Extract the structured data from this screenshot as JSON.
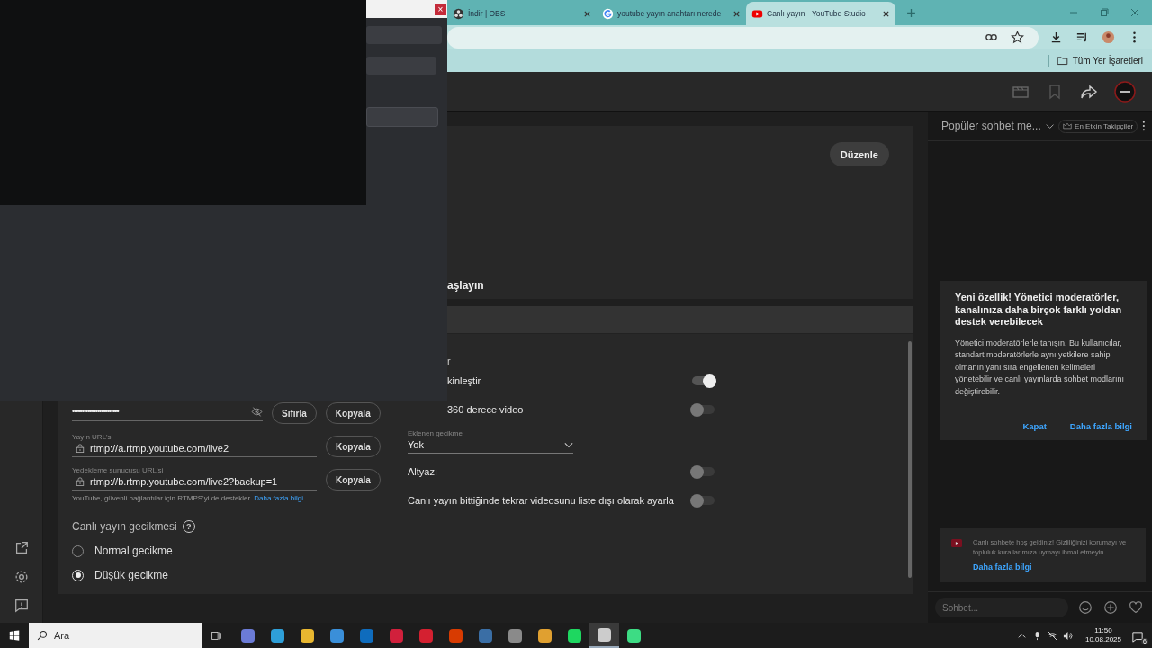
{
  "browser": {
    "tabs": [
      {
        "title": "İndir | OBS",
        "kind": "obs",
        "selected": false
      },
      {
        "title": "youtube yayın anahtarı nerede",
        "kind": "google",
        "selected": false
      },
      {
        "title": "Canlı yayın - YouTube Studio",
        "kind": "youtube",
        "selected": true
      }
    ],
    "bookmarks_folder": "Tüm Yer İşaretleri"
  },
  "overlay_window": {
    "close": "×"
  },
  "studio": {
    "edit_button": "Düzenle",
    "partial_heading": "aşlayın",
    "section_fragment": "r",
    "stream_key": {
      "masked": "••••••••••••••••••••••••",
      "reset": "Sıfırla",
      "copy": "Kopyala"
    },
    "stream_url": {
      "label": "Yayın URL'si",
      "value": "rtmp://a.rtmp.youtube.com/live2",
      "copy": "Kopyala"
    },
    "backup_url": {
      "label": "Yedekleme sunucusu URL'si",
      "value": "rtmp://b.rtmp.youtube.com/live2?backup=1",
      "copy": "Kopyala"
    },
    "rtmps_note": "YouTube, güvenli bağlantılar için RTMPS'yi de destekler.",
    "learn_more": "Daha fazla bilgi",
    "latency": {
      "title": "Canlı yayın gecikmesi",
      "help": "?",
      "options": [
        {
          "label": "Normal gecikme",
          "selected": false
        },
        {
          "label": "Düşük gecikme",
          "selected": true
        }
      ]
    },
    "settings": [
      {
        "kind": "toggle",
        "label": "kinleştir",
        "on": true
      },
      {
        "kind": "toggle",
        "label": "360 derece video",
        "on": false
      },
      {
        "kind": "select",
        "label": "Eklenen gecikme",
        "value": "Yok"
      },
      {
        "kind": "toggle",
        "label": "Altyazı",
        "on": false
      },
      {
        "kind": "toggle",
        "label": "Canlı yayın bittiğinde tekrar videosunu liste dışı olarak ayarla",
        "on": false
      }
    ]
  },
  "chat": {
    "sort": "Popüler sohbet me...",
    "top_fans": "En Etkin Takipçiler",
    "tip": {
      "title": "Yeni özellik! Yönetici moderatörler, kanalınıza daha birçok farklı yoldan destek verebilecek",
      "body": "Yönetici moderatörlerle tanışın. Bu kullanıcılar, standart moderatörlerle aynı yetkilere sahip olmanın yanı sıra engellenen kelimeleri yönetebilir ve canlı yayınlarda sohbet modlarını değiştirebilir.",
      "dismiss": "Kapat",
      "learn": "Daha fazla bilgi"
    },
    "welcome": {
      "text": "Canlı sohbete hoş geldiniz! Gizliliğinizi korumayı ve topluluk kurallarımıza uymayı ihmal etmeyin.",
      "link": "Daha fazla bilgi"
    },
    "input_placeholder": "Sohbet..."
  },
  "taskbar": {
    "search_placeholder": "Ara",
    "time": "11:50",
    "date": "10.08.2025",
    "notifications": "6",
    "apps": [
      {
        "color": "#6b7bd6",
        "selected": false
      },
      {
        "color": "#2e9fd8",
        "selected": false
      },
      {
        "color": "#e8b730",
        "selected": false
      },
      {
        "color": "#3a8fd9",
        "selected": false
      },
      {
        "color": "#0f6cbd",
        "selected": false
      },
      {
        "color": "#d1203c",
        "selected": false
      },
      {
        "color": "#d42030",
        "selected": false
      },
      {
        "color": "#d83b01",
        "selected": false
      },
      {
        "color": "#3a6ea5",
        "selected": false
      },
      {
        "color": "#8a8a8a",
        "selected": false
      },
      {
        "color": "#e0a030",
        "selected": false
      },
      {
        "color": "#1ed760",
        "selected": false
      },
      {
        "color": "#cccccc",
        "selected": true
      },
      {
        "color": "#3ddc84",
        "selected": false
      }
    ]
  }
}
